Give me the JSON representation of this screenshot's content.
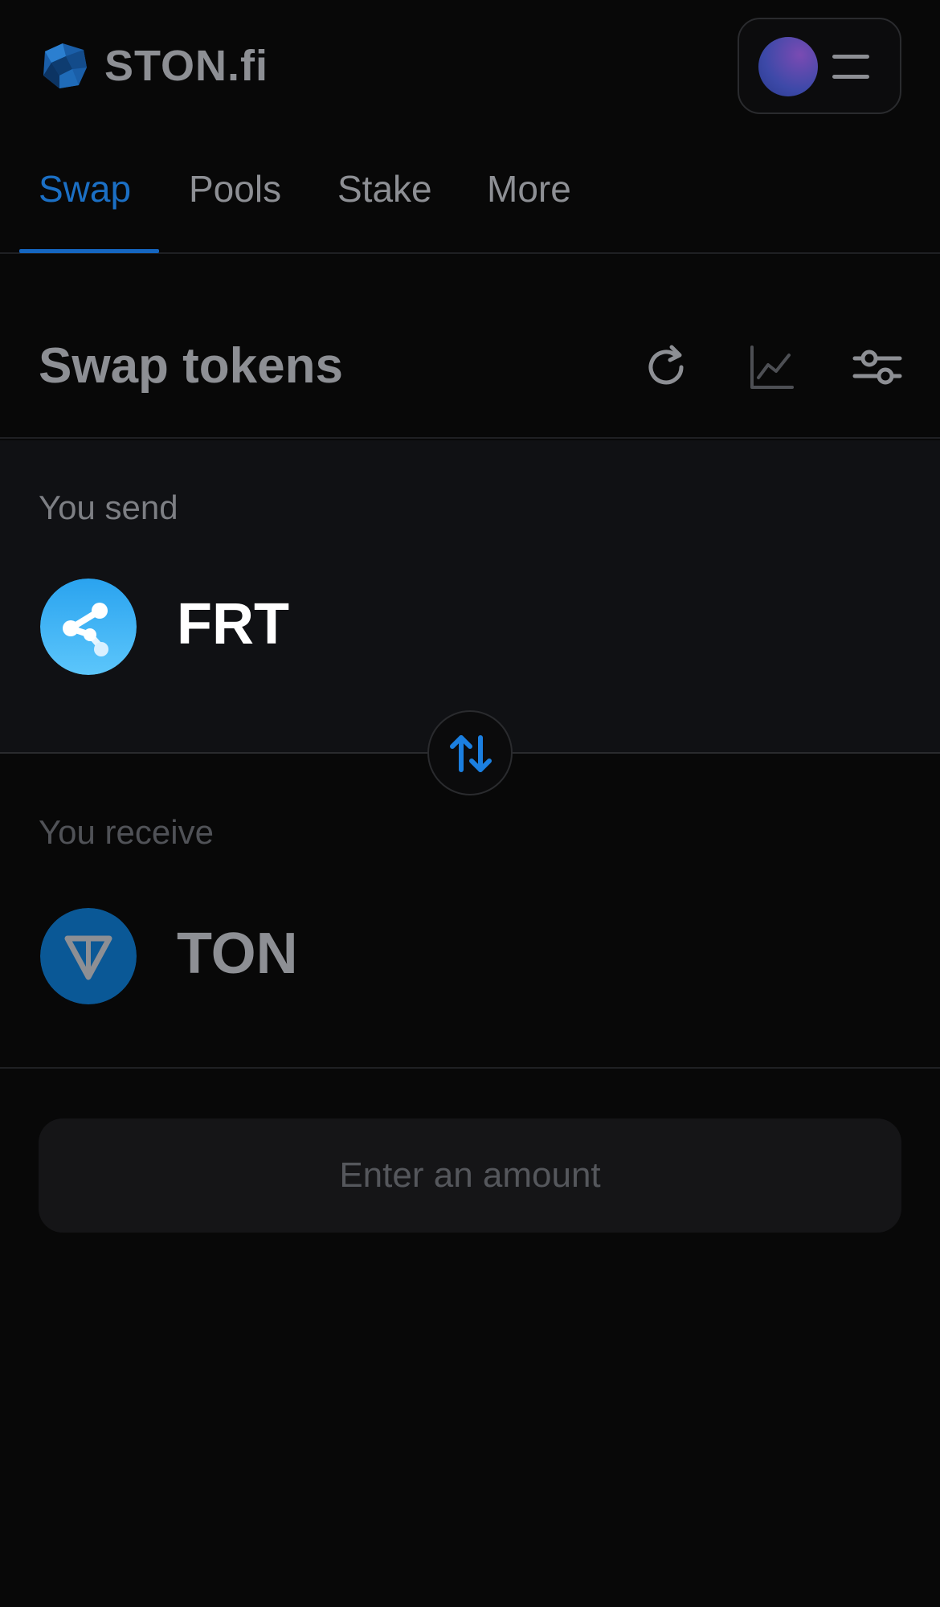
{
  "header": {
    "brand": "STON.fi",
    "logo_icon": "ston-logo-icon",
    "menu_icon": "hamburger-icon"
  },
  "nav": {
    "tabs": [
      {
        "label": "Swap",
        "active": true
      },
      {
        "label": "Pools",
        "active": false
      },
      {
        "label": "Stake",
        "active": false
      },
      {
        "label": "More",
        "active": false
      }
    ]
  },
  "swap": {
    "title": "Swap tokens",
    "tools": [
      "refresh-icon",
      "chart-icon",
      "settings-sliders-icon"
    ],
    "send": {
      "label": "You send",
      "token": "FRT"
    },
    "receive": {
      "label": "You receive",
      "token": "TON"
    },
    "direction_icon": "swap-arrows-icon",
    "action_label": "Enter an amount"
  },
  "colors": {
    "accent": "#1b6fc4",
    "background": "#080808",
    "panel": "#101114"
  }
}
